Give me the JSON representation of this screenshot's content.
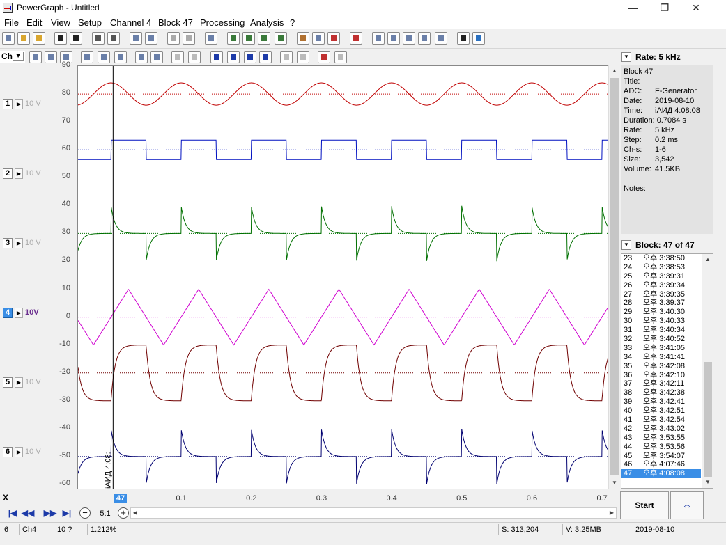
{
  "window": {
    "title": "PowerGraph - Untitled",
    "minimize": "—",
    "maximize": "❐",
    "close": "✕"
  },
  "menu": [
    "File",
    "Edit",
    "View",
    "Setup",
    "Channel 4",
    "Block 47",
    "Processing",
    "Analysis",
    "?"
  ],
  "channel_selector": {
    "value": "Ch",
    "arrow": "▼"
  },
  "channels": [
    {
      "num": "1",
      "volt": "10 V",
      "color": "#c00000",
      "active": false,
      "yticks": [
        "90",
        "80",
        "70"
      ]
    },
    {
      "num": "2",
      "volt": "10 V",
      "color": "#0010c0",
      "active": false,
      "yticks": [
        "60",
        "50"
      ]
    },
    {
      "num": "3",
      "volt": "10 V",
      "color": "#007000",
      "active": false,
      "yticks": [
        "40",
        "30",
        "20"
      ]
    },
    {
      "num": "4",
      "volt": "10V",
      "color": "#d000d0",
      "active": true,
      "yticks": [
        "10",
        "0",
        "-10"
      ]
    },
    {
      "num": "5",
      "volt": "10 V",
      "color": "#700000",
      "active": false,
      "yticks": [
        "-20",
        "-30"
      ]
    },
    {
      "num": "6",
      "volt": "10 V",
      "color": "#000070",
      "active": false,
      "yticks": [
        "-40",
        "-50",
        "-60"
      ]
    }
  ],
  "chart_data": {
    "type": "line",
    "title": "",
    "xlabel": "",
    "ylabel": "",
    "x_ticks": [
      "0.1",
      "0.2",
      "0.3",
      "0.4",
      "0.5",
      "0.6",
      "0.7"
    ],
    "y_ticks": [
      "90",
      "80",
      "70",
      "60",
      "50",
      "40",
      "30",
      "20",
      "10",
      "0",
      "-10",
      "-20",
      "-30",
      "-40",
      "-50",
      "-60"
    ],
    "ylim": [
      -62,
      90
    ],
    "xlim": [
      -0.0485,
      0.7085
    ],
    "marker_label": "47",
    "marker_time_text": "iАИД 4:08:",
    "series": [
      {
        "channel": 1,
        "shape": "sine",
        "offset": 80,
        "amplitude": 4,
        "period": 0.1,
        "color": "#c00000"
      },
      {
        "channel": 2,
        "shape": "square",
        "high": 63.5,
        "low": 56.5,
        "baseline": 60,
        "period": 0.1,
        "color": "#0010c0"
      },
      {
        "channel": 3,
        "shape": "spike",
        "baseline": 30,
        "peak_up": 40,
        "peak_down": 20,
        "period": 0.1,
        "color": "#007000"
      },
      {
        "channel": 4,
        "shape": "triangle",
        "baseline": 0,
        "max": 10,
        "min": -10,
        "period": 0.1,
        "color": "#d000d0"
      },
      {
        "channel": 5,
        "shape": "rc-square",
        "baseline": -20,
        "high": -10,
        "low": -30,
        "period": 0.1,
        "color": "#700000"
      },
      {
        "channel": 6,
        "shape": "spike",
        "baseline": -50,
        "peak_up": -40,
        "peak_down": -60,
        "period": 0.1,
        "color": "#000070"
      }
    ],
    "grid": false
  },
  "x_panel": {
    "label": "X",
    "marker": "47",
    "ticks": [
      "0.1",
      "0.2",
      "0.3",
      "0.4",
      "0.5",
      "0.6",
      "0.7"
    ]
  },
  "zoom": {
    "minus": "−",
    "value": "5:1",
    "plus": "+"
  },
  "rate": {
    "label": "Rate: 5 kHz"
  },
  "block_info": [
    {
      "k": "Block 47",
      "v": ""
    },
    {
      "k": "Title:",
      "v": ""
    },
    {
      "k": "ADC:",
      "v": "F-Generator"
    },
    {
      "k": "Date:",
      "v": "2019-08-10"
    },
    {
      "k": "Time:",
      "v": "iАИД 4:08:08"
    },
    {
      "k": "Duration: 0.7084 s",
      "v": ""
    },
    {
      "k": "Rate:",
      "v": "5 kHz"
    },
    {
      "k": "Step:",
      "v": "0.2 ms"
    },
    {
      "k": "Ch-s:",
      "v": "1-6"
    },
    {
      "k": "Size:",
      "v": "3,542"
    },
    {
      "k": "Volume:",
      "v": "41.5KB"
    },
    {
      "k": "",
      "v": ""
    },
    {
      "k": "Notes:",
      "v": ""
    }
  ],
  "block_list": {
    "header": "Block:  47 of 47",
    "items": [
      {
        "n": "23",
        "t": "오후  3:38:50"
      },
      {
        "n": "24",
        "t": "오후  3:38:53"
      },
      {
        "n": "25",
        "t": "오후  3:39:31"
      },
      {
        "n": "26",
        "t": "오후  3:39:34"
      },
      {
        "n": "27",
        "t": "오후  3:39:35"
      },
      {
        "n": "28",
        "t": "오후  3:39:37"
      },
      {
        "n": "29",
        "t": "오후  3:40:30"
      },
      {
        "n": "30",
        "t": "오후  3:40:33"
      },
      {
        "n": "31",
        "t": "오후  3:40:34"
      },
      {
        "n": "32",
        "t": "오후  3:40:52"
      },
      {
        "n": "33",
        "t": "오후  3:41:05"
      },
      {
        "n": "34",
        "t": "오후  3:41:41"
      },
      {
        "n": "35",
        "t": "오후  3:42:08"
      },
      {
        "n": "36",
        "t": "오후  3:42:10"
      },
      {
        "n": "37",
        "t": "오후  3:42:11"
      },
      {
        "n": "38",
        "t": "오후  3:42:38"
      },
      {
        "n": "39",
        "t": "오후  3:42:41"
      },
      {
        "n": "40",
        "t": "오후  3:42:51"
      },
      {
        "n": "41",
        "t": "오후  3:42:54"
      },
      {
        "n": "42",
        "t": "오후  3:43:02"
      },
      {
        "n": "43",
        "t": "오후  3:53:55"
      },
      {
        "n": "44",
        "t": "오후  3:53:56"
      },
      {
        "n": "45",
        "t": "오후  3:54:07"
      },
      {
        "n": "46",
        "t": "오후  4:07:46"
      },
      {
        "n": "47",
        "t": "오후  4:08:08",
        "selected": true
      }
    ]
  },
  "buttons": {
    "start": "Start",
    "bus": "⇔"
  },
  "status": {
    "c1": "6",
    "c2": "Ch4",
    "c3": "10 ?",
    "c4": "1.212%",
    "c5": "S: 313,204",
    "c6": "V: 3.25MB",
    "c7": "2019-08-10"
  }
}
